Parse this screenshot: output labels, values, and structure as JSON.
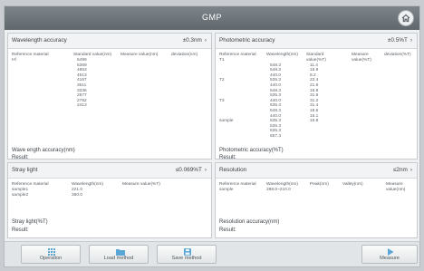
{
  "window": {
    "title": "GMP"
  },
  "icons": {
    "home": "home-icon",
    "operation": "grid-icon",
    "load": "folder-icon",
    "save": "save-icon",
    "measure": "play-icon"
  },
  "wavelength": {
    "title": "Wavelength accuracy",
    "std": "±0.3nm",
    "headers": [
      "Reference material",
      "Standard value(nm)",
      "Measure value(nm)",
      "deviation(nm)"
    ],
    "material": "Hf",
    "values": [
      "6499",
      "5369",
      "4853",
      "4513",
      "4167",
      "3611",
      "3336",
      "2877",
      "2782",
      "2413"
    ],
    "accuracy_label": "Wave ength accuracy(nm)",
    "result_label": "Result:"
  },
  "photometric": {
    "title": "Photometric accuracy",
    "std": "±0.5%T",
    "headers": [
      "Reference material",
      "Wavelength(nm)",
      "Standard value(%T)",
      "Measure value(%T)",
      "deviation(%T)"
    ],
    "materials": [
      "T1",
      "",
      "",
      "",
      "T2",
      "",
      "",
      "",
      "T3",
      "",
      "",
      "",
      "sample",
      "",
      ""
    ],
    "wavelengths": [
      "",
      "548.3",
      "548.3",
      "440.0",
      "535.3",
      "440.0",
      "548.3",
      "535.3",
      "440.0",
      "535.3",
      "548.3",
      "440.0",
      "535.3",
      "535.3",
      "635.3",
      "657.3"
    ],
    "standard": [
      "",
      "11.4",
      "15.9",
      "8.2",
      "22.4",
      "21.9",
      "15.8",
      "31.9",
      "31.2",
      "31.4",
      "18.6",
      "15.1",
      "15.8"
    ],
    "accuracy_label": "Photometric accuracy(%T)",
    "result_label": "Result:"
  },
  "stray": {
    "title": "Stray light",
    "std": "≤0.069%T",
    "headers": [
      "Reference material",
      "Wavelength(nm)",
      "Measure value(%T)"
    ],
    "rows": [
      {
        "material": "sample1",
        "wavelength": "221.0"
      },
      {
        "material": "sample2",
        "wavelength": "360.0"
      }
    ],
    "accuracy_label": "Stray light(%T)",
    "result_label": "Result:"
  },
  "resolution": {
    "title": "Resolution",
    "std": "≤2nm",
    "headers": [
      "Reference material",
      "Wavelength(nm)",
      "Peak(nm)",
      "Valley(nm)",
      "Measure value(nm)"
    ],
    "material": "sample",
    "range": "288.0~210.0",
    "accuracy_label": "Resolution accuracy(nm)",
    "result_label": "Result:"
  },
  "toolbar": {
    "operation": "Operation",
    "load": "Load method",
    "save": "Save method",
    "measure": "Measure"
  }
}
